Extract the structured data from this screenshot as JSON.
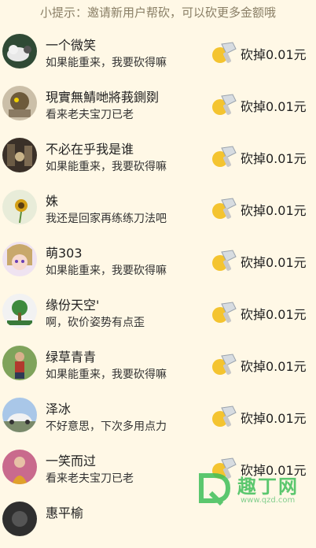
{
  "tip": "小提示：邀请新用户帮砍，可以砍更多金额哦",
  "items": [
    {
      "name": "一个微笑",
      "msg": "如果能重来，我要砍得嘛",
      "amount": "砍掉0.01元"
    },
    {
      "name": "現實無鯖哋將莪鍘剟",
      "msg": "看来老夫宝刀已老",
      "amount": "砍掉0.01元"
    },
    {
      "name": "不必在乎我是谁",
      "msg": "如果能重来，我要砍得嘛",
      "amount": "砍掉0.01元"
    },
    {
      "name": "姝",
      "msg": "我还是回家再练练刀法吧",
      "amount": "砍掉0.01元"
    },
    {
      "name": "萌303",
      "msg": "如果能重来，我要砍得嘛",
      "amount": "砍掉0.01元"
    },
    {
      "name": "缘份天空'",
      "msg": "啊，砍价姿势有点歪",
      "amount": "砍掉0.01元"
    },
    {
      "name": "绿草青青",
      "msg": "如果能重来，我要砍得嘛",
      "amount": "砍掉0.01元"
    },
    {
      "name": "泽冰",
      "msg": "不好意思，下次多用点力",
      "amount": "砍掉0.01元"
    },
    {
      "name": "一笑而过",
      "msg": "看来老夫宝刀已老",
      "amount": "砍掉0.01元"
    },
    {
      "name": "惠平榆",
      "msg": "",
      "amount": ""
    }
  ],
  "colors": {
    "background": "#fff8e6",
    "coin": "#f4c430",
    "knife": "#9aa3ad"
  },
  "watermark": {
    "title": "趣丁网",
    "url": "www.qzd.com"
  }
}
